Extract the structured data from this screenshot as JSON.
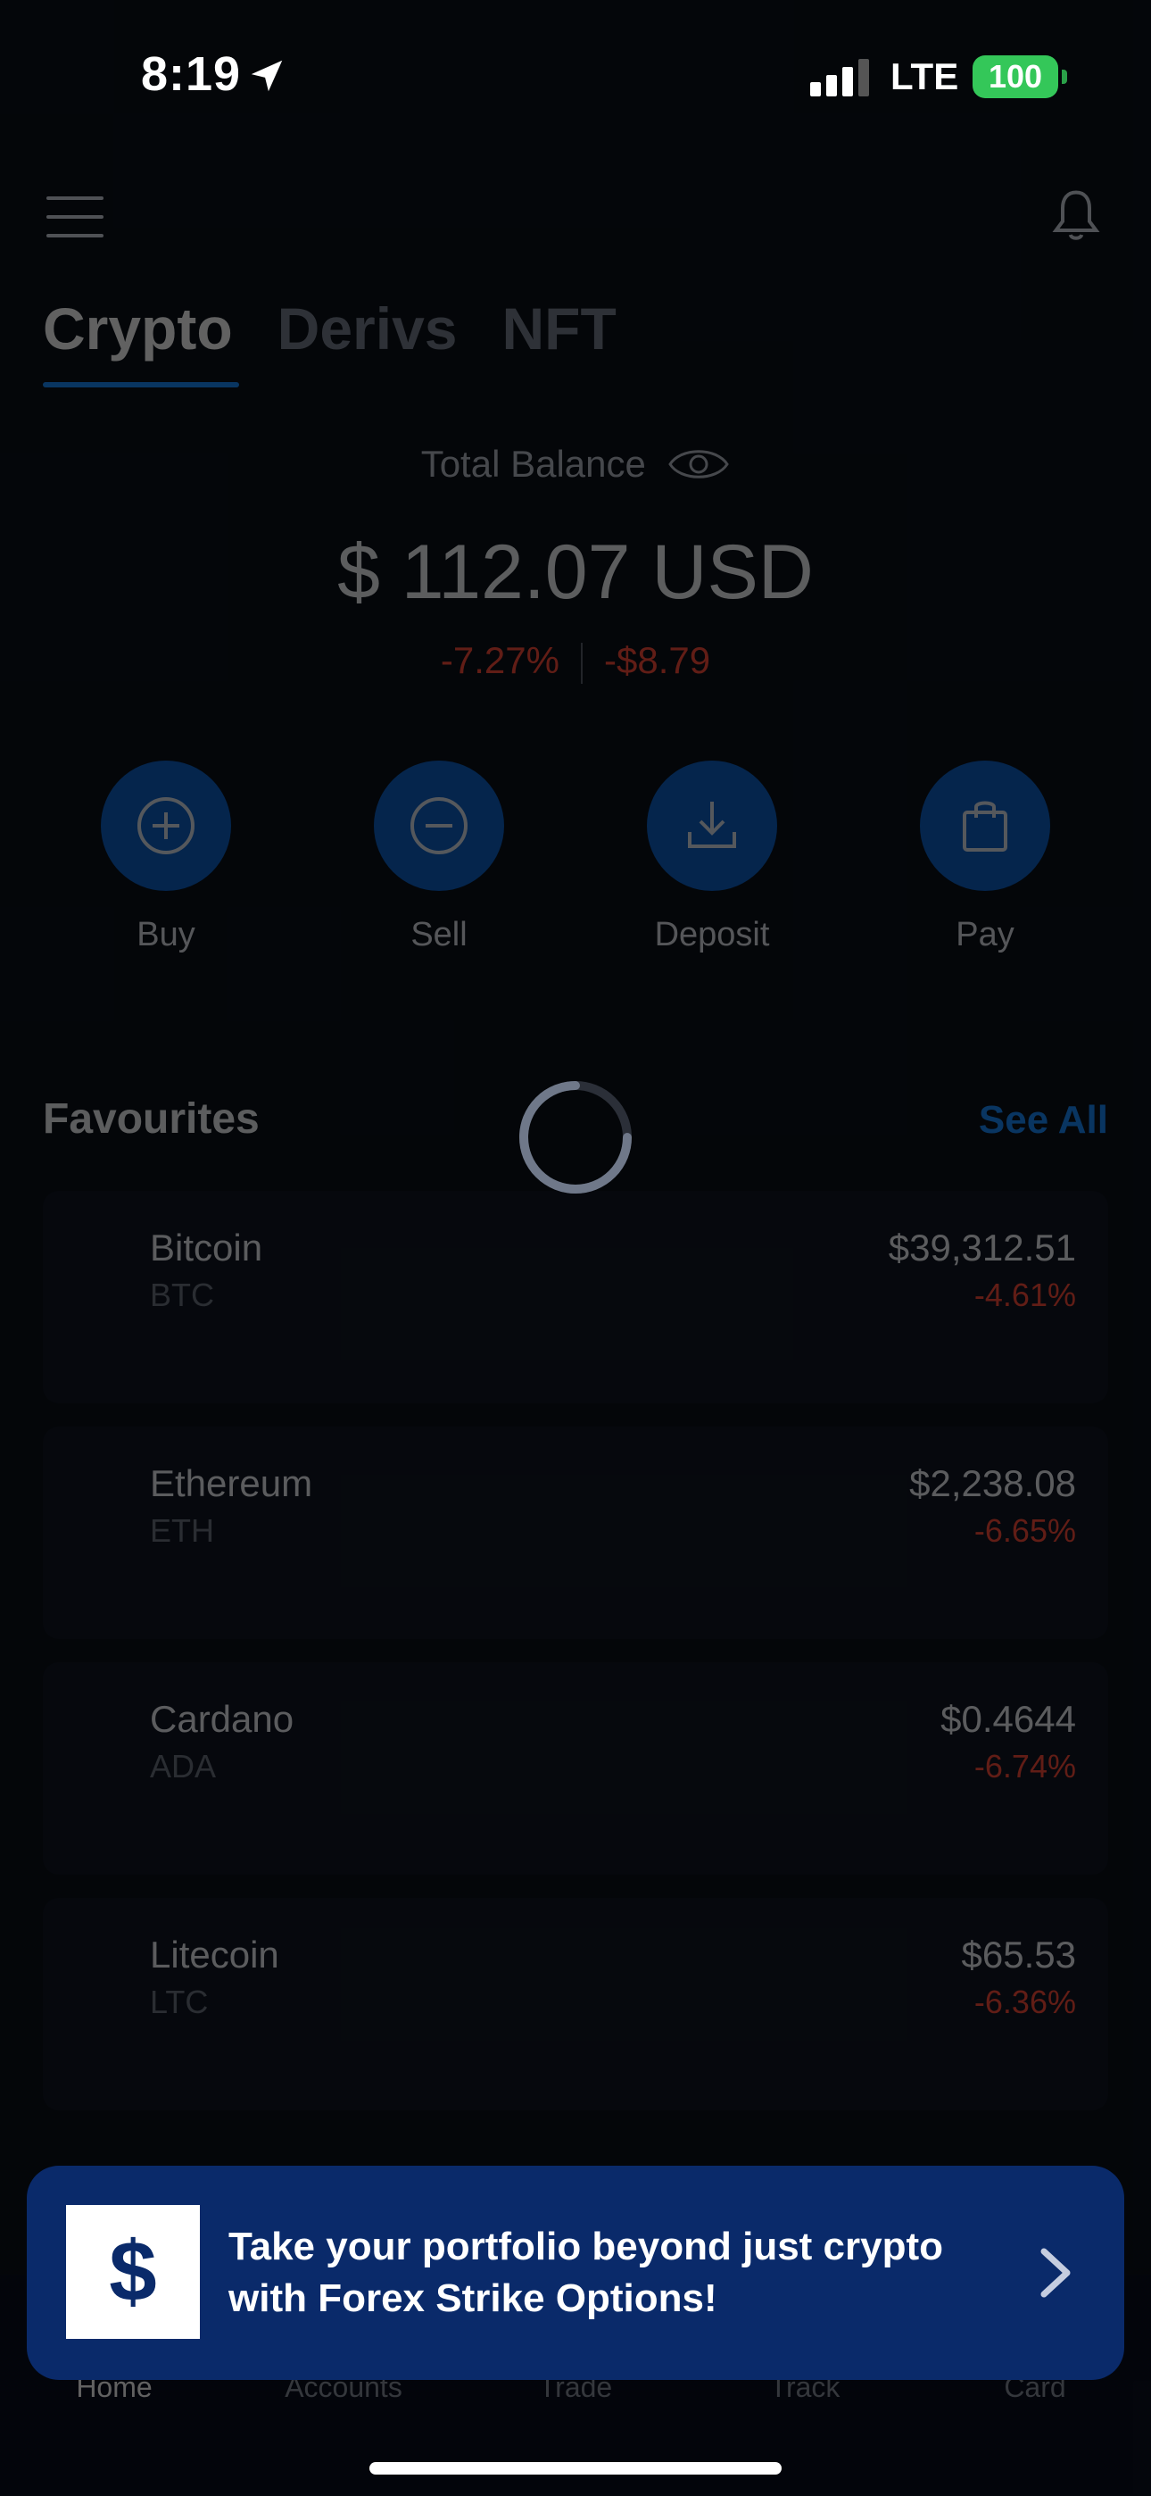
{
  "status_bar": {
    "time": "8:19",
    "network": "LTE",
    "battery": "100"
  },
  "tabs": [
    {
      "label": "Crypto",
      "active": true
    },
    {
      "label": "Derivs",
      "active": false
    },
    {
      "label": "NFT",
      "active": false
    }
  ],
  "balance": {
    "label": "Total Balance",
    "amount": "$ 112.07 USD",
    "change_percent": "-7.27%",
    "change_value": "-$8.79"
  },
  "actions": [
    {
      "label": "Buy",
      "icon": "plus-circle-icon"
    },
    {
      "label": "Sell",
      "icon": "minus-circle-icon"
    },
    {
      "label": "Deposit",
      "icon": "download-icon"
    },
    {
      "label": "Pay",
      "icon": "shopping-bag-icon"
    }
  ],
  "favourites": {
    "title": "Favourites",
    "see_all": "See All",
    "items": [
      {
        "name": "Bitcoin",
        "symbol": "BTC",
        "price": "$39,312.51",
        "change": "-4.61%"
      },
      {
        "name": "Ethereum",
        "symbol": "ETH",
        "price": "$2,238.08",
        "change": "-6.65%"
      },
      {
        "name": "Cardano",
        "symbol": "ADA",
        "price": "$0.4644",
        "change": "-6.74%"
      },
      {
        "name": "Litecoin",
        "symbol": "LTC",
        "price": "$65.53",
        "change": "-6.36%"
      }
    ]
  },
  "banner": {
    "logo": "$",
    "text": "Take your portfolio beyond just crypto with Forex Strike Options!"
  },
  "bottom_nav": [
    {
      "label": "Home",
      "active": true
    },
    {
      "label": "Accounts",
      "active": false
    },
    {
      "label": "Trade",
      "active": false
    },
    {
      "label": "Track",
      "active": false
    },
    {
      "label": "Card",
      "active": false
    }
  ],
  "colors": {
    "accent": "#1a8cff",
    "negative": "#ff4d3a",
    "banner": "#0a2a6a",
    "battery": "#34c759"
  }
}
